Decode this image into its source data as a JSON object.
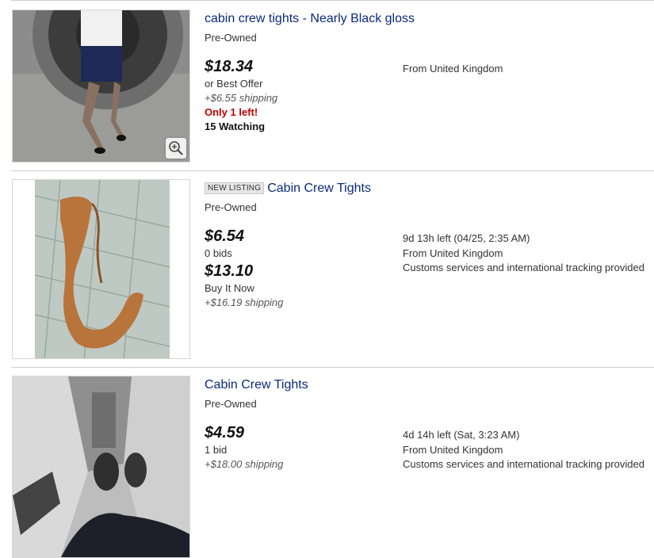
{
  "listings": [
    {
      "title": "cabin crew tights - Nearly Black gloss",
      "condition": "Pre-Owned",
      "price": "$18.34",
      "offer": "or Best Offer",
      "shipping": "+$6.55 shipping",
      "stock": "Only 1 left!",
      "watching": "15 Watching",
      "location": "From United Kingdom",
      "image_icon": "zoom-in-icon"
    },
    {
      "badge": "NEW LISTING",
      "title": "Cabin Crew Tights",
      "condition": "Pre-Owned",
      "price": "$6.54",
      "bids": "0 bids",
      "bin_price": "$13.10",
      "bin_label": "Buy It Now",
      "shipping": "+$16.19 shipping",
      "time_left": "9d 13h left (04/25, 2:35 AM)",
      "location": "From United Kingdom",
      "customs": "Customs services and international tracking provided"
    },
    {
      "title": "Cabin Crew Tights",
      "condition": "Pre-Owned",
      "price": "$4.59",
      "bids": "1 bid",
      "shipping": "+$18.00 shipping",
      "time_left": "4d 14h left (Sat, 3:23 AM)",
      "location": "From United Kingdom",
      "customs": "Customs services and international tracking provided"
    }
  ],
  "colors": {
    "title_link": "#0a2a7a",
    "urgent": "#c00000",
    "divider": "#cfcfcf"
  }
}
